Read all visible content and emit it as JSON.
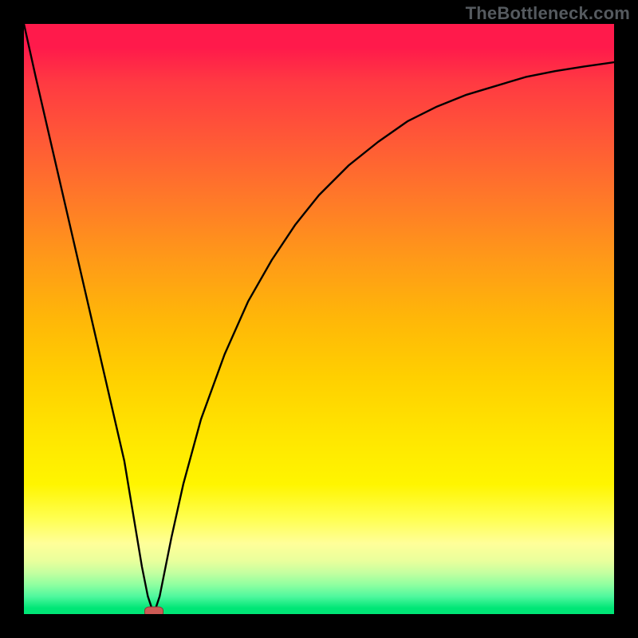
{
  "watermark": "TheBottleneck.com",
  "colors": {
    "frame": "#000000",
    "gradient_top": "#ff1a4b",
    "gradient_mid": "#ffe600",
    "gradient_bottom": "#00e676",
    "marker_fill": "#cc5a55",
    "marker_stroke": "#8a3a38",
    "curve": "#000000"
  },
  "icon_names": {
    "watermark": "watermark-text",
    "marker": "minimum-marker"
  },
  "chart_data": {
    "type": "line",
    "title": "",
    "xlabel": "",
    "ylabel": "",
    "xlim": [
      0,
      100
    ],
    "ylim": [
      0,
      100
    ],
    "grid": false,
    "legend": false,
    "marker": {
      "x": 22,
      "y": 0
    },
    "series": [
      {
        "name": "bottleneck-curve",
        "x": [
          0,
          2,
          5,
          8,
          11,
          14,
          17,
          19,
          20,
          21,
          22,
          23,
          24,
          25,
          27,
          30,
          34,
          38,
          42,
          46,
          50,
          55,
          60,
          65,
          70,
          75,
          80,
          85,
          90,
          95,
          100
        ],
        "y": [
          100,
          91,
          78,
          65,
          52,
          39,
          26,
          14,
          8,
          3,
          0,
          3,
          8,
          13,
          22,
          33,
          44,
          53,
          60,
          66,
          71,
          76,
          80,
          83.5,
          86,
          88,
          89.5,
          91,
          92,
          92.8,
          93.5
        ]
      }
    ]
  }
}
